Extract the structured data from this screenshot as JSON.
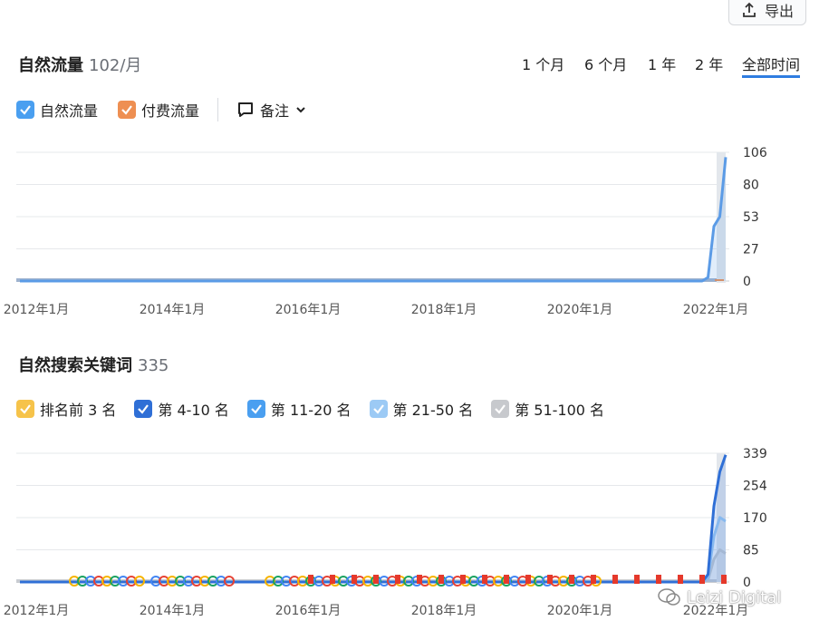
{
  "export": {
    "label": "导出"
  },
  "traffic": {
    "title": "自然流量",
    "count": "102/月",
    "ranges": [
      "1 个月",
      "6 个月",
      "1 年",
      "2 年",
      "全部时间"
    ],
    "active_range": "全部时间",
    "legend": [
      {
        "label": "自然流量",
        "color": "#4a9ff0"
      },
      {
        "label": "付费流量",
        "color": "#ee8f52"
      }
    ],
    "notes_label": "备注"
  },
  "keywords": {
    "title": "自然搜索关键词",
    "count": "335",
    "legend": [
      {
        "label": "排名前 3 名",
        "color": "#f6c34a"
      },
      {
        "label": "第 4-10 名",
        "color": "#2f6fd6"
      },
      {
        "label": "第 11-20 名",
        "color": "#4a9ff0"
      },
      {
        "label": "第 21-50 名",
        "color": "#9ccaf5"
      },
      {
        "label": "第 51-100 名",
        "color": "#c7c9cd"
      }
    ]
  },
  "chart_data": [
    {
      "type": "area",
      "x_tick_labels": [
        "2012年1月",
        "2014年1月",
        "2016年1月",
        "2018年1月",
        "2020年1月",
        "2022年1月"
      ],
      "y_tick_labels": [
        "106",
        "80",
        "53",
        "27",
        "0"
      ],
      "ylim": [
        0,
        106
      ],
      "grid": true,
      "series": [
        {
          "name": "自然流量",
          "color": "#5b9be6",
          "x": [
            "2012-01",
            "2021-09",
            "2021-10",
            "2021-11",
            "2021-12",
            "2022-01"
          ],
          "values": [
            0,
            0,
            3,
            45,
            53,
            102
          ]
        },
        {
          "name": "付费流量",
          "color": "#ee8f52",
          "x": [
            "2012-01",
            "2022-01"
          ],
          "values": [
            0,
            0
          ]
        }
      ]
    },
    {
      "type": "area",
      "x_tick_labels": [
        "2012年1月",
        "2014年1月",
        "2016年1月",
        "2018年1月",
        "2020年1月",
        "2022年1月"
      ],
      "y_tick_labels": [
        "339",
        "254",
        "170",
        "85",
        "0"
      ],
      "ylim": [
        0,
        339
      ],
      "grid": true,
      "series": [
        {
          "name": "第 4-10 名",
          "color": "#2f6fd6",
          "x": [
            "2012-01",
            "2021-09",
            "2021-10",
            "2021-11",
            "2021-12",
            "2022-01"
          ],
          "values": [
            0,
            0,
            20,
            200,
            290,
            335
          ]
        },
        {
          "name": "第 21-50 名",
          "color": "#9ccaf5",
          "x": [
            "2012-01",
            "2021-09",
            "2021-10",
            "2021-11",
            "2021-12",
            "2022-01"
          ],
          "values": [
            0,
            0,
            10,
            120,
            170,
            160
          ]
        },
        {
          "name": "第 51-100 名",
          "color": "#c7c9cd",
          "x": [
            "2012-01",
            "2021-09",
            "2021-10",
            "2021-11",
            "2021-12",
            "2022-01"
          ],
          "values": [
            0,
            0,
            5,
            60,
            85,
            75
          ]
        }
      ]
    }
  ],
  "watermark": "Leizi Digital"
}
